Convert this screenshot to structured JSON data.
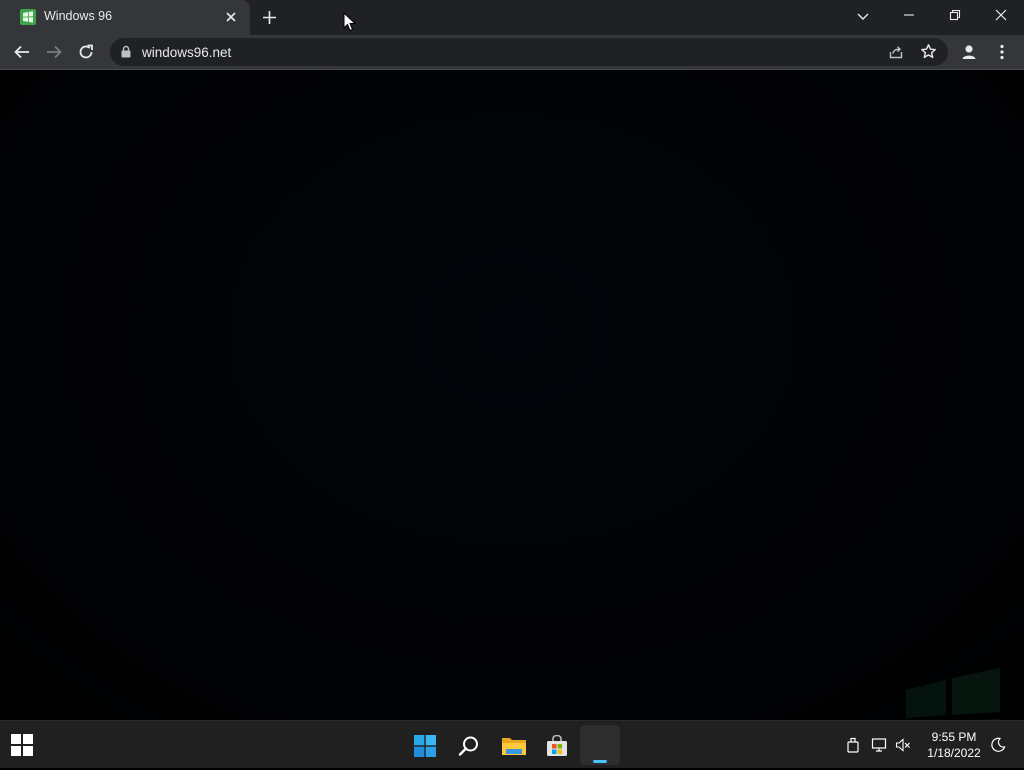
{
  "browser": {
    "tab": {
      "title": "Windows 96"
    },
    "omnibox": {
      "url": "windows96.net"
    }
  },
  "taskbar": {
    "clock": {
      "time": "9:55 PM",
      "date": "1/18/2022"
    },
    "apps": [
      "start-icon",
      "search-icon",
      "file-explorer-icon",
      "store-icon",
      "browser-icon"
    ],
    "tray": [
      "usb-icon",
      "network-icon",
      "volume-muted-icon",
      "focus-assist-icon"
    ]
  },
  "colors": {
    "titlebar": "#202124",
    "toolbar": "#35363a",
    "omnibox": "#202124",
    "taskbar": "#202020",
    "accent": "#4cc2ff",
    "favicon": "#3fa34d"
  }
}
